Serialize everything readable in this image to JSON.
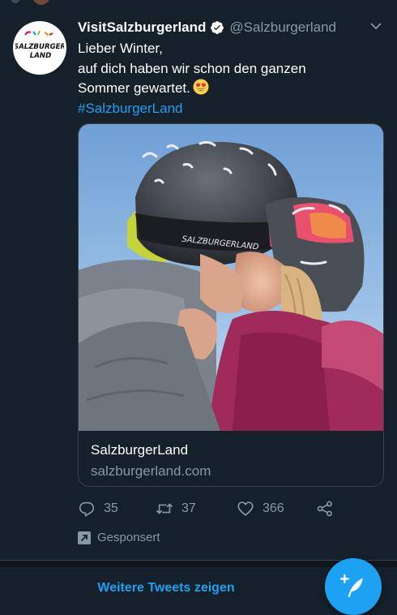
{
  "tweet": {
    "display_name": "VisitSalzburgerland",
    "handle": "@Salzburgerland",
    "text_lines": [
      "Lieber Winter,",
      "auf dich haben wir schon den ganzen",
      "Sommer gewartet."
    ],
    "hashtag": "#SalzburgerLand",
    "avatar_logo_line1": "SALZBURGER",
    "avatar_logo_line2": "LAND",
    "image_goggle_strap_text": "SALZBURGERLAND"
  },
  "card": {
    "title": "SalzburgerLand",
    "domain": "salzburgerland.com"
  },
  "actions": {
    "replies": "35",
    "retweets": "37",
    "likes": "366"
  },
  "promoted_label": "Gesponsert",
  "footer": {
    "more_tweets_label": "Weitere Tweets zeigen"
  },
  "colors": {
    "background": "#15202b",
    "accent": "#1da1f2",
    "secondary_text": "#8899a6",
    "border": "#38444d"
  },
  "icons": [
    "chevron-down-icon",
    "verified-badge-icon",
    "heart-eyes-emoji",
    "reply-icon",
    "retweet-icon",
    "like-icon",
    "share-icon",
    "promoted-icon",
    "compose-tweet-icon"
  ]
}
